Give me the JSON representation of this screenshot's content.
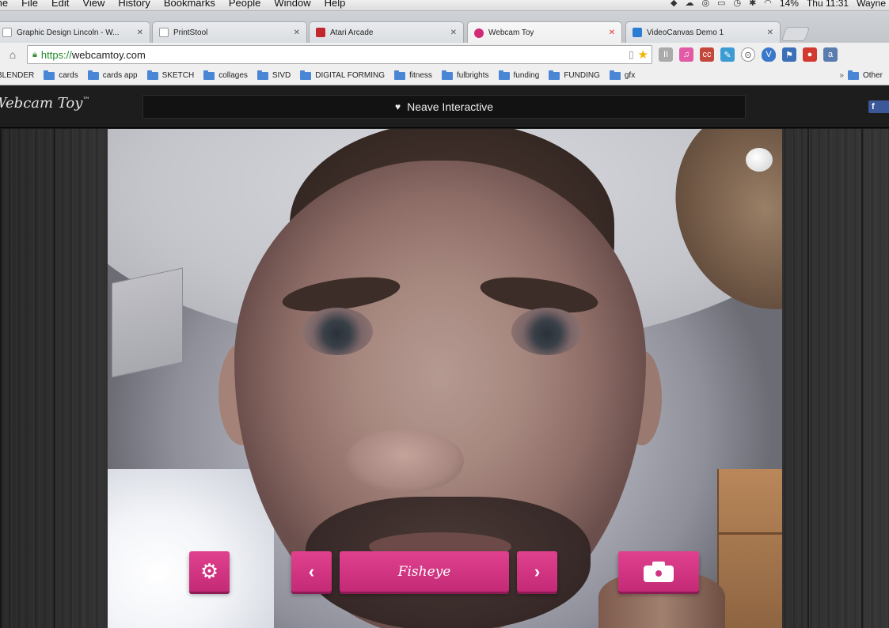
{
  "menubar": {
    "items": [
      "me",
      "File",
      "Edit",
      "View",
      "History",
      "Bookmarks",
      "People",
      "Window",
      "Help"
    ],
    "status": {
      "battery": "14%",
      "clock": "Thu 11:31",
      "user": "Wayne"
    }
  },
  "tabs": [
    {
      "title": "Graphic Design Lincoln - W...",
      "color": "#e8e8e8"
    },
    {
      "title": "PrintStool",
      "color": "#ffffff"
    },
    {
      "title": "Atari Arcade",
      "color": "#c1272d"
    },
    {
      "title": "Webcam Toy",
      "color": "#d12a77"
    },
    {
      "title": "VideoCanvas Demo 1",
      "color": "#2b7cd3"
    }
  ],
  "address": {
    "scheme": "https://",
    "host": "webcamtoy.com"
  },
  "bookmarks": {
    "first": "BLENDER",
    "folders": [
      "cards",
      "cards app",
      "SKETCH",
      "collages",
      "SIVD",
      "DIGITAL FORMING",
      "fitness",
      "fulbrights",
      "funding",
      "FUNDING",
      "gfx"
    ],
    "more": "Other"
  },
  "site": {
    "logo": "Webcam Toy",
    "logo_mark": "™",
    "banner": "Neave Interactive",
    "facebook": "f"
  },
  "controls": {
    "filter_name": "Fisheye",
    "prev_symbol": "‹",
    "next_symbol": "›",
    "settings_symbol": "⚙"
  },
  "colors": {
    "accent": "#d6327f",
    "header": "#1d1d1d"
  }
}
